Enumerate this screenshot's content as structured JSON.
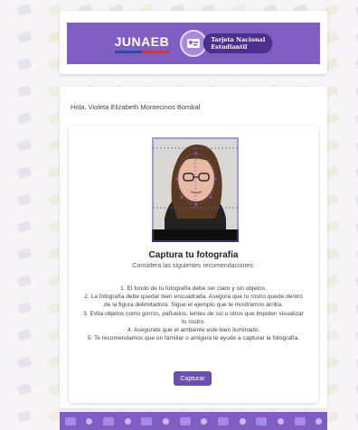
{
  "header": {
    "brand_name": "JUNAEB",
    "product_line1": "Tarjeta Nacional",
    "product_line2": "Estudiantil",
    "banner_color": "#7f5dc3",
    "brand_stripe_colors": [
      "#1f4fa8",
      "#d9372a"
    ]
  },
  "greeting": "Hola, Violeta Elizabeth Montecinos Bombal",
  "instructions": {
    "title": "Captura tu fotografía",
    "subtitle": "Considera las siguientes recomendaciones:",
    "items": [
      "1. El fondo de tu fotografía debe ser claro y sin objetos.",
      "2. La fotografía debe quedar bien encuadrada. Asegura que tu rostro quede dentro de la figura delimitadora. Sigue el ejemplo que te mostramos arriba.",
      "3. Evita objetos como gorros, pañuelos, lentes de sol u otros que impiden visualizar tu rostro.",
      "4. Asegúrate que el ambiente este bien iluminado.",
      "5. Te recomendamos que un familiar o amigo/a te ayude a capturar la fotografía."
    ]
  },
  "capture_button": "Capturar",
  "accent_color": "#6b4fae",
  "icons": [
    "card-icon",
    "face-guide-overlay"
  ]
}
